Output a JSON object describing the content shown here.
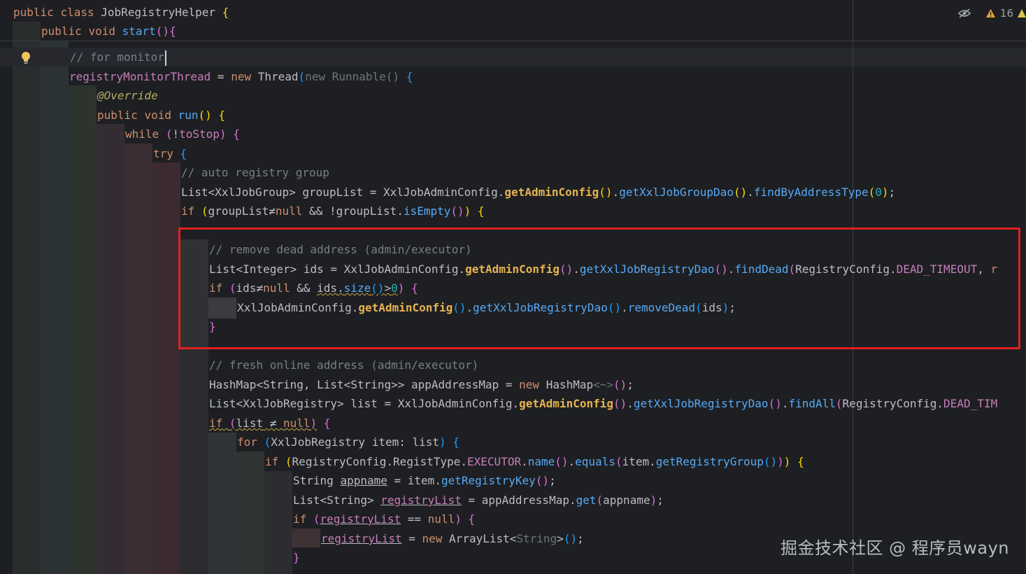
{
  "editor": {
    "inspection": {
      "warnings_count": "16"
    },
    "watermark": "掘金技术社区 @ 程序员wayn",
    "tokens": {
      "public": "public",
      "class": "class",
      "void": "void",
      "new": "new",
      "while": "while",
      "try": "try",
      "if": "if",
      "for": "for",
      "null": "null",
      "JobRegistryHelper": "JobRegistryHelper",
      "start": "start",
      "run": "run",
      "comment_monitor": "// for monitor",
      "registryMonitorThread": "registryMonitorThread",
      "Thread": "Thread",
      "Runnable": "new Runnable()",
      "override": "@Override",
      "toStop": "toStop",
      "comment_auto": "// auto registry group",
      "List": "List",
      "XxlJobGroup": "XxlJobGroup",
      "groupList": "groupList",
      "XxlJobAdminConfig": "XxlJobAdminConfig",
      "getAdminConfig": "getAdminConfig",
      "getXxlJobGroupDao": "getXxlJobGroupDao",
      "findByAddressType": "findByAddressType",
      "zero": "0",
      "isEmpty": "isEmpty",
      "comment_remove": "// remove dead address (admin/executor)",
      "Integer": "Integer",
      "ids": "ids",
      "getXxlJobRegistryDao": "getXxlJobRegistryDao",
      "findDead": "findDead",
      "RegistryConfig": "RegistryConfig",
      "DEAD_TIMEOUT": "DEAD_TIMEOUT",
      "size": "size",
      "removeDead": "removeDead",
      "comment_fresh": "// fresh online address (admin/executor)",
      "HashMap": "HashMap",
      "String": "String",
      "appAddressMap": "appAddressMap",
      "diamond": "<~>",
      "XxlJobRegistry": "XxlJobRegistry",
      "list": "list",
      "findAll": "findAll",
      "DEAD_TIM": "DEAD_TIM",
      "item": "item",
      "RegistType": "RegistType",
      "EXECUTOR": "EXECUTOR",
      "name": "name",
      "equals": "equals",
      "getRegistryGroup": "getRegistryGroup",
      "appname": "appname",
      "getRegistryKey": "getRegistryKey",
      "registryList": "registryList",
      "get": "get",
      "ArrayList": "ArrayList",
      "r_trunc": "r"
    }
  }
}
